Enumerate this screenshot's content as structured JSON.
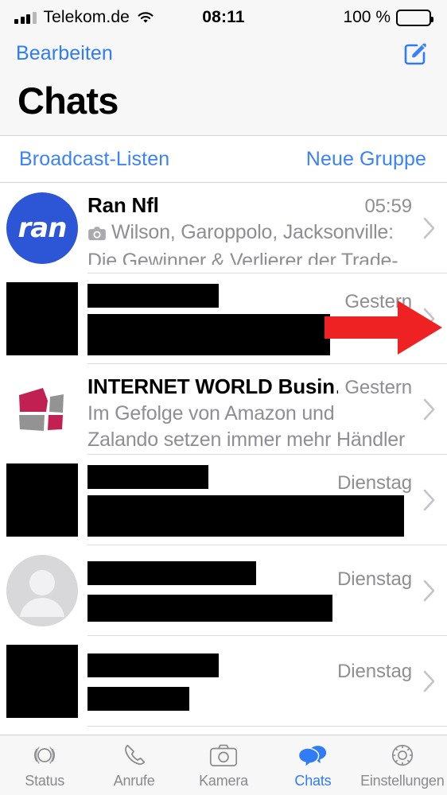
{
  "status_bar": {
    "carrier": "Telekom.de",
    "signal_icon": "cellular-bars-icon",
    "wifi_icon": "wifi-icon",
    "time": "08:11",
    "battery_percent": "100 %",
    "battery_icon": "battery-full-icon"
  },
  "header": {
    "edit_label": "Bearbeiten",
    "title": "Chats",
    "compose_icon": "compose-new-message-icon"
  },
  "action_bar": {
    "broadcast_label": "Broadcast-Listen",
    "new_group_label": "Neue Gruppe"
  },
  "annotation": {
    "arrow_icon": "red-arrow-right-annotation",
    "color": "#ee2222"
  },
  "colors": {
    "accent_blue": "#2f7cf6",
    "link_blue": "#3b82f7",
    "secondary_text": "#8e8e93",
    "separator": "#dcdcdc",
    "bar_background": "#f7f7f7",
    "ran_avatar_blue": "#2d56d6",
    "iw_logo_crimson": "#c02052",
    "iw_logo_gray": "#939393",
    "redaction_black": "#000000"
  },
  "chats": [
    {
      "id": "ran-nfl",
      "name": "Ran Nfl",
      "time": "05:59",
      "avatar_type": "ran-logo",
      "avatar_text": "ran",
      "has_camera_icon": true,
      "preview": "Wilson, Garoppolo, Jacksonville: Die Gewinner & Verlierer der Trade-Deadl…",
      "redacted": false
    },
    {
      "id": "redacted-1",
      "name": "",
      "time": "Gestern",
      "avatar_type": "redacted",
      "has_camera_icon": false,
      "preview": "",
      "redacted": true
    },
    {
      "id": "internet-world-business",
      "name": "INTERNET WORLD Busin…",
      "time": "Gestern",
      "avatar_type": "internet-world-logo",
      "has_camera_icon": false,
      "preview": "Im Gefolge von Amazon und Zalando setzen immer mehr Händler auf Plattf…",
      "redacted": false
    },
    {
      "id": "redacted-2",
      "name": "",
      "time": "Dienstag",
      "avatar_type": "redacted",
      "has_camera_icon": false,
      "preview": "",
      "redacted": true
    },
    {
      "id": "redacted-3",
      "name": "",
      "time": "Dienstag",
      "avatar_type": "person-placeholder",
      "has_camera_icon": false,
      "preview": "",
      "redacted": true
    },
    {
      "id": "redacted-4",
      "name": "",
      "time": "Dienstag",
      "avatar_type": "redacted",
      "has_camera_icon": false,
      "preview": "",
      "redacted": true
    }
  ],
  "tab_bar": {
    "active_tab": "Chats",
    "tabs": [
      {
        "label": "Status",
        "icon": "status-rings-icon",
        "active": false
      },
      {
        "label": "Anrufe",
        "icon": "phone-handset-icon",
        "active": false
      },
      {
        "label": "Kamera",
        "icon": "camera-icon",
        "active": false
      },
      {
        "label": "Chats",
        "icon": "chat-bubbles-icon",
        "active": true
      },
      {
        "label": "Einstellungen",
        "icon": "gear-icon",
        "active": false
      }
    ]
  }
}
